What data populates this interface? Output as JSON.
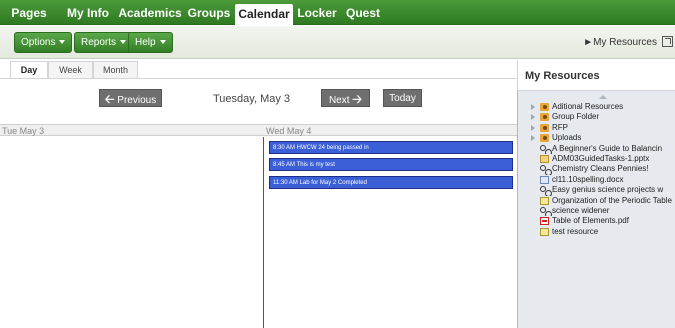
{
  "topnav": {
    "tabs": [
      {
        "label": "Pages",
        "active": false
      },
      {
        "label": "My Info",
        "active": false
      },
      {
        "label": "Academics",
        "active": false
      },
      {
        "label": "Groups",
        "active": false
      },
      {
        "label": "Calendar",
        "active": true
      },
      {
        "label": "Locker",
        "active": false
      },
      {
        "label": "Quest",
        "active": false
      }
    ]
  },
  "toolbar": {
    "options_label": "Options",
    "reports_label": "Reports",
    "help_label": "Help",
    "my_resources_link": "►My Resources"
  },
  "calendar": {
    "view_tabs": [
      "Day",
      "Week",
      "Month"
    ],
    "active_view": "Day",
    "previous_label": "Previous",
    "next_label": "Next",
    "today_label": "Today",
    "current_date": "Tuesday, May 3",
    "columns": [
      {
        "header": "Tue May 3",
        "events": []
      },
      {
        "header": "Wed May 4",
        "events": [
          "8:30 AM HWCW 24 being passed in",
          "8:45 AM This is my test",
          "11:30 AM Lab for May 2 Completed"
        ]
      }
    ],
    "event_color": "#3b5fd6"
  },
  "resources": {
    "title": "My Resources",
    "items": [
      {
        "label": "Aditional Resources",
        "icon": "folder-icon",
        "expandable": true
      },
      {
        "label": "Group Folder",
        "icon": "folder-icon",
        "expandable": true
      },
      {
        "label": "RFP",
        "icon": "folder-icon",
        "expandable": true
      },
      {
        "label": "Uploads",
        "icon": "folder-icon",
        "expandable": true
      },
      {
        "label": "A Beginner's Guide to Balancin",
        "icon": "link-icon",
        "expandable": false
      },
      {
        "label": "ADM03GuidedTasks-1.pptx",
        "icon": "pptx-file-icon",
        "expandable": false
      },
      {
        "label": "Chemistry Cleans Pennies!",
        "icon": "link-icon",
        "expandable": false
      },
      {
        "label": "cl11.10spelling.docx",
        "icon": "docx-file-icon",
        "expandable": false
      },
      {
        "label": "Easy genius science projects w",
        "icon": "link-icon",
        "expandable": false
      },
      {
        "label": "Organization of the Periodic Table",
        "icon": "text-file-icon",
        "expandable": false
      },
      {
        "label": "science widener",
        "icon": "link-icon",
        "expandable": false
      },
      {
        "label": "Table of Elements.pdf",
        "icon": "pdf-file-icon",
        "expandable": false
      },
      {
        "label": "test resource",
        "icon": "text-file-icon",
        "expandable": false
      }
    ]
  },
  "colors": {
    "nav_green": "#2f7a22",
    "button_green": "#337f25",
    "nav_button_gray": "#6f6f6f",
    "panel_bg": "#e6e9ee"
  }
}
